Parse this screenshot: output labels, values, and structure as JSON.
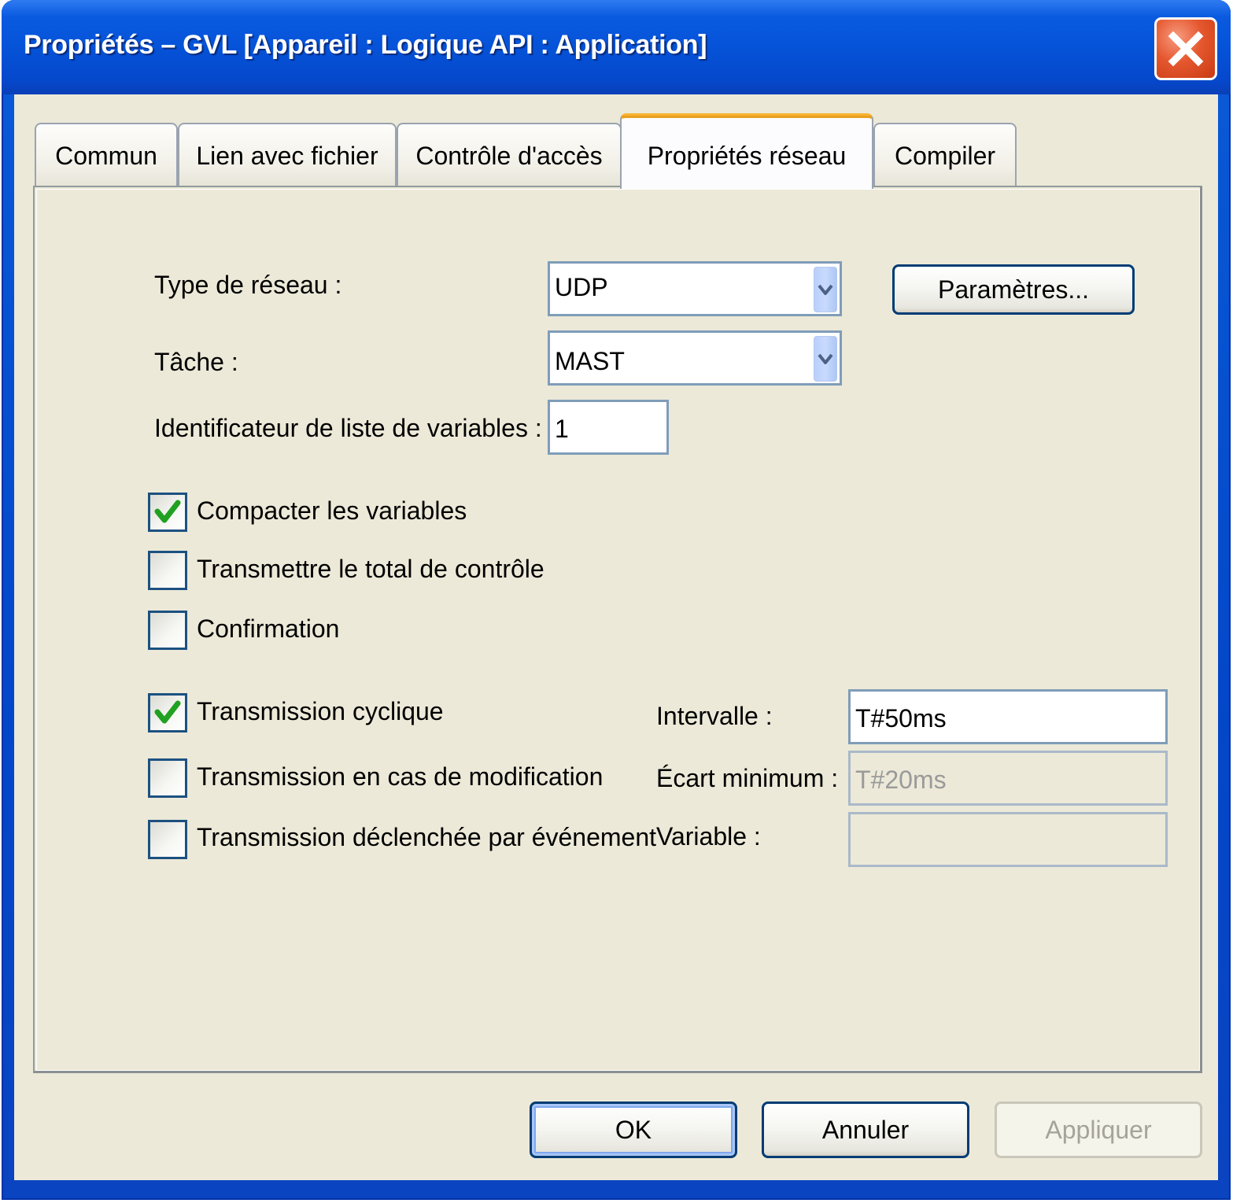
{
  "window": {
    "title": "Propriétés – GVL [Appareil : Logique API : Application]"
  },
  "tabs": [
    {
      "label": "Commun",
      "active": false
    },
    {
      "label": "Lien avec fichier",
      "active": false
    },
    {
      "label": "Contrôle d'accès",
      "active": false
    },
    {
      "label": "Propriétés réseau",
      "active": true
    },
    {
      "label": "Compiler",
      "active": false
    }
  ],
  "form": {
    "network_type": {
      "label": "Type de réseau :",
      "value": "UDP"
    },
    "parameters_button": "Paramètres...",
    "task": {
      "label": "Tâche :",
      "value": "MAST"
    },
    "variable_list_id": {
      "label": "Identificateur de liste de variables :",
      "value": "1"
    },
    "options": [
      {
        "label": "Compacter les variables",
        "checked": true
      },
      {
        "label": "Transmettre le total de contrôle",
        "checked": false
      },
      {
        "label": "Confirmation",
        "checked": false
      }
    ],
    "transmission": [
      {
        "label": "Transmission cyclique",
        "checked": true
      },
      {
        "label": "Transmission en cas de modification",
        "checked": false
      },
      {
        "label": "Transmission déclenchée par événement",
        "checked": false
      }
    ],
    "interval": {
      "label": "Intervalle :",
      "value": "T#50ms"
    },
    "min_gap": {
      "label": "Écart minimum :",
      "value": "T#20ms"
    },
    "variable": {
      "label": "Variable :",
      "value": ""
    }
  },
  "buttons": {
    "ok": "OK",
    "cancel": "Annuler",
    "apply": "Appliquer"
  },
  "colors": {
    "titlebar": "#0553d8",
    "dialog_bg": "#ece9d8",
    "active_tab_accent": "#f8b232",
    "check_green": "#21a121",
    "close_button": "#e5582f"
  },
  "icons": {
    "close": "close-icon",
    "dropdown": "chevron-down-icon",
    "check": "checkmark-icon"
  }
}
